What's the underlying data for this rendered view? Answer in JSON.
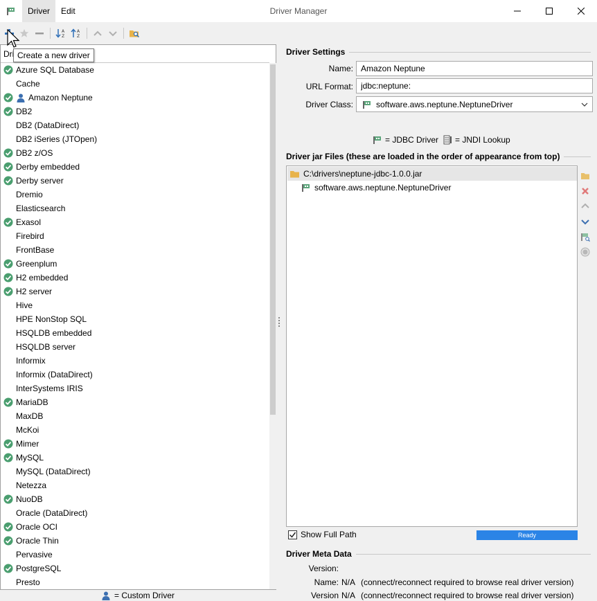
{
  "window": {
    "title": "Driver Manager",
    "menu": [
      "Driver",
      "Edit"
    ]
  },
  "tooltip": "Create a new driver",
  "filter": {
    "value": "Dri"
  },
  "drivers": [
    {
      "name": "Azure SQL Database",
      "check": true,
      "custom": false
    },
    {
      "name": "Cache",
      "check": false,
      "custom": false
    },
    {
      "name": "Amazon Neptune",
      "check": true,
      "custom": true
    },
    {
      "name": "DB2",
      "check": true,
      "custom": false
    },
    {
      "name": "DB2 (DataDirect)",
      "check": false,
      "custom": false
    },
    {
      "name": "DB2 iSeries (JTOpen)",
      "check": false,
      "custom": false
    },
    {
      "name": "DB2 z/OS",
      "check": true,
      "custom": false
    },
    {
      "name": "Derby embedded",
      "check": true,
      "custom": false
    },
    {
      "name": "Derby server",
      "check": true,
      "custom": false
    },
    {
      "name": "Dremio",
      "check": false,
      "custom": false
    },
    {
      "name": "Elasticsearch",
      "check": false,
      "custom": false
    },
    {
      "name": "Exasol",
      "check": true,
      "custom": false
    },
    {
      "name": "Firebird",
      "check": false,
      "custom": false
    },
    {
      "name": "FrontBase",
      "check": false,
      "custom": false
    },
    {
      "name": "Greenplum",
      "check": true,
      "custom": false
    },
    {
      "name": "H2 embedded",
      "check": true,
      "custom": false
    },
    {
      "name": "H2 server",
      "check": true,
      "custom": false
    },
    {
      "name": "Hive",
      "check": false,
      "custom": false
    },
    {
      "name": "HPE NonStop SQL",
      "check": false,
      "custom": false
    },
    {
      "name": "HSQLDB embedded",
      "check": false,
      "custom": false
    },
    {
      "name": "HSQLDB server",
      "check": false,
      "custom": false
    },
    {
      "name": "Informix",
      "check": false,
      "custom": false
    },
    {
      "name": "Informix (DataDirect)",
      "check": false,
      "custom": false
    },
    {
      "name": "InterSystems IRIS",
      "check": false,
      "custom": false
    },
    {
      "name": "MariaDB",
      "check": true,
      "custom": false
    },
    {
      "name": "MaxDB",
      "check": false,
      "custom": false
    },
    {
      "name": "McKoi",
      "check": false,
      "custom": false
    },
    {
      "name": "Mimer",
      "check": true,
      "custom": false
    },
    {
      "name": "MySQL",
      "check": true,
      "custom": false
    },
    {
      "name": "MySQL (DataDirect)",
      "check": false,
      "custom": false
    },
    {
      "name": "Netezza",
      "check": false,
      "custom": false
    },
    {
      "name": "NuoDB",
      "check": true,
      "custom": false
    },
    {
      "name": "Oracle (DataDirect)",
      "check": false,
      "custom": false
    },
    {
      "name": "Oracle OCI",
      "check": true,
      "custom": false
    },
    {
      "name": "Oracle Thin",
      "check": true,
      "custom": false
    },
    {
      "name": "Pervasive",
      "check": false,
      "custom": false
    },
    {
      "name": "PostgreSQL",
      "check": true,
      "custom": false
    },
    {
      "name": "Presto",
      "check": false,
      "custom": false
    }
  ],
  "legend": {
    "custom_driver": "= Custom Driver"
  },
  "settings": {
    "section_title": "Driver Settings",
    "name_label": "Name:",
    "name_value": "Amazon Neptune",
    "url_label": "URL Format:",
    "url_value": "jdbc:neptune:",
    "class_label": "Driver Class:",
    "class_value": "software.aws.neptune.NeptuneDriver",
    "jdbc_legend": "= JDBC Driver",
    "jndi_legend": "= JNDI Lookup"
  },
  "jars": {
    "section_title": "Driver jar Files (these are loaded in the order of appearance from top)",
    "file": "C:\\drivers\\neptune-jdbc-1.0.0.jar",
    "driver_class": "software.aws.neptune.NeptuneDriver",
    "show_full_path": "Show Full Path",
    "status": "Ready"
  },
  "meta": {
    "section_title": "Driver Meta Data",
    "version_label": "Version:",
    "version_value": "",
    "name_label": "Name:",
    "name_value": "N/A",
    "name_note": "(connect/reconnect required to browse real driver version)",
    "version_string_label": "Version String:",
    "version_string_value": "N/A",
    "version_string_note": "(connect/reconnect required to browse real driver version)"
  },
  "colors": {
    "check_green": "#4a9e6f",
    "accent_blue": "#2b84e6",
    "custom_blue": "#3c6fb0",
    "delete_red": "#d9534f"
  }
}
